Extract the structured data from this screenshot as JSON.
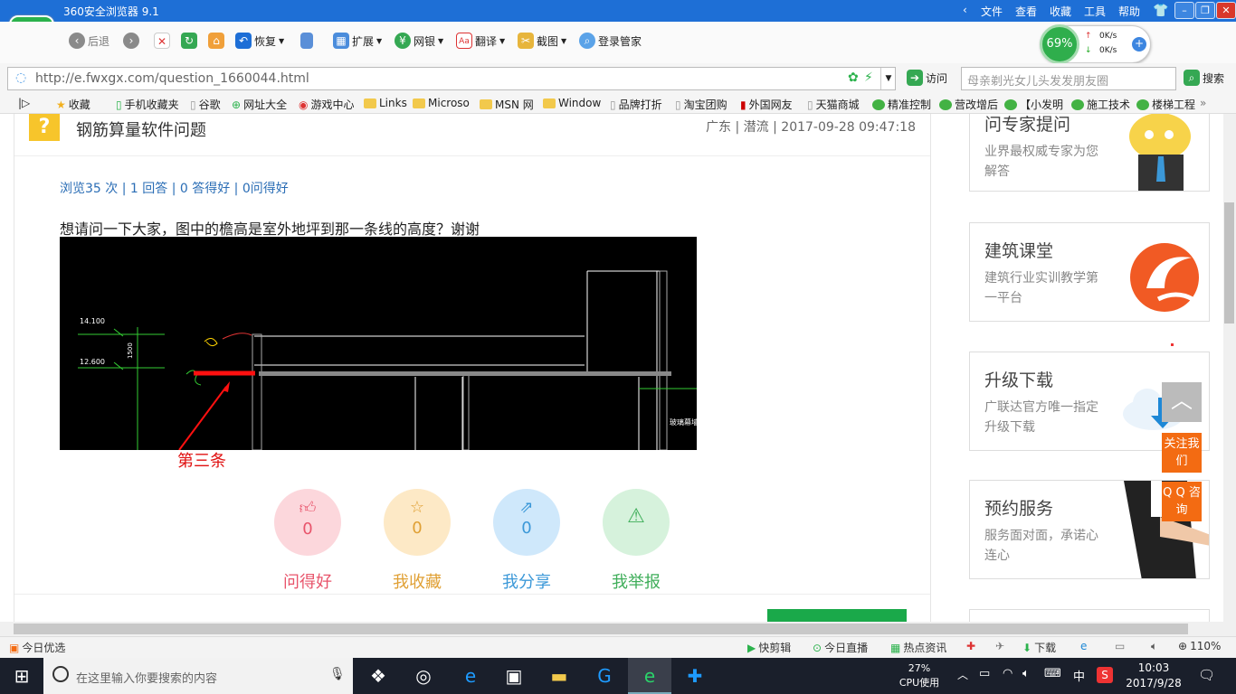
{
  "browser": {
    "title": "360安全浏览器 9.1",
    "menu": [
      "文件",
      "查看",
      "收藏",
      "工具",
      "帮助"
    ],
    "toolbar": {
      "back": "后退",
      "restore": "恢复",
      "extend": "扩展",
      "bank": "网银",
      "translate": "翻译",
      "screenshot": "截图",
      "login": "登录管家"
    },
    "speed": {
      "percent": "69%",
      "up": "0K/s",
      "down": "0K/s"
    },
    "address": "http://e.fwxgx.com/question_1660044.html",
    "visit": "访问",
    "search_placeholder": "母亲剃光女儿头发发朋友圈",
    "search_btn": "搜索",
    "bookmarks": [
      "收藏",
      "手机收藏夹",
      "谷歌",
      "网址大全",
      "游戏中心",
      "Links",
      "Microso",
      "MSN 网",
      "Window",
      "品牌打折",
      "淘宝团购",
      "外国网友",
      "天猫商城",
      "精准控制",
      "营改增后",
      "【小发明",
      "施工技术",
      "楼梯工程"
    ]
  },
  "question": {
    "title": "钢筋算量软件问题",
    "meta": "广东 | 潜流 | 2017-09-28 09:47:18",
    "stats": "浏览35 次 | 1 回答 | 0 答得好 | 0问得好",
    "body": "想请问一下大家，图中的檐高是室外地坪到那一条线的高度？谢谢",
    "drawing": {
      "label1": "14.100",
      "label2": "12.600",
      "label3": "1500",
      "label4": "玻璃幕墙"
    },
    "arrow_label": "第三条",
    "actions": [
      {
        "count": "0",
        "label": "问得好",
        "color": "#e8546b",
        "bg": "#fcd7dc"
      },
      {
        "count": "0",
        "label": "我收藏",
        "color": "#e0a034",
        "bg": "#fde9c6"
      },
      {
        "count": "0",
        "label": "我分享",
        "color": "#3b98d8",
        "bg": "#cfe8fb"
      },
      {
        "count": "0",
        "label": "我举报",
        "color": "#3fae5a",
        "bg": "#d6f2dc"
      }
    ]
  },
  "ads": [
    {
      "title": "问专家提问",
      "desc": "业界最权威专家为您解答"
    },
    {
      "title": "建筑课堂",
      "desc": "建筑行业实训教学第一平台"
    },
    {
      "title": "升级下载",
      "desc": "广联达官方唯一指定升级下载"
    },
    {
      "title": "预约服务",
      "desc": "服务面对面，承诺心连心"
    }
  ],
  "float": {
    "follow": "关注我们",
    "qq": "Q Q 咨询"
  },
  "statusbar": {
    "left": "今日优选",
    "items": [
      "快剪辑",
      "今日直播",
      "热点资讯",
      "下载"
    ],
    "zoom": "110%"
  },
  "taskbar": {
    "search_placeholder": "在这里输入你要搜索的内容",
    "cpu_pct": "27%",
    "cpu_label": "CPU使用",
    "ime": "中",
    "time": "10:03",
    "date": "2017/9/28"
  }
}
